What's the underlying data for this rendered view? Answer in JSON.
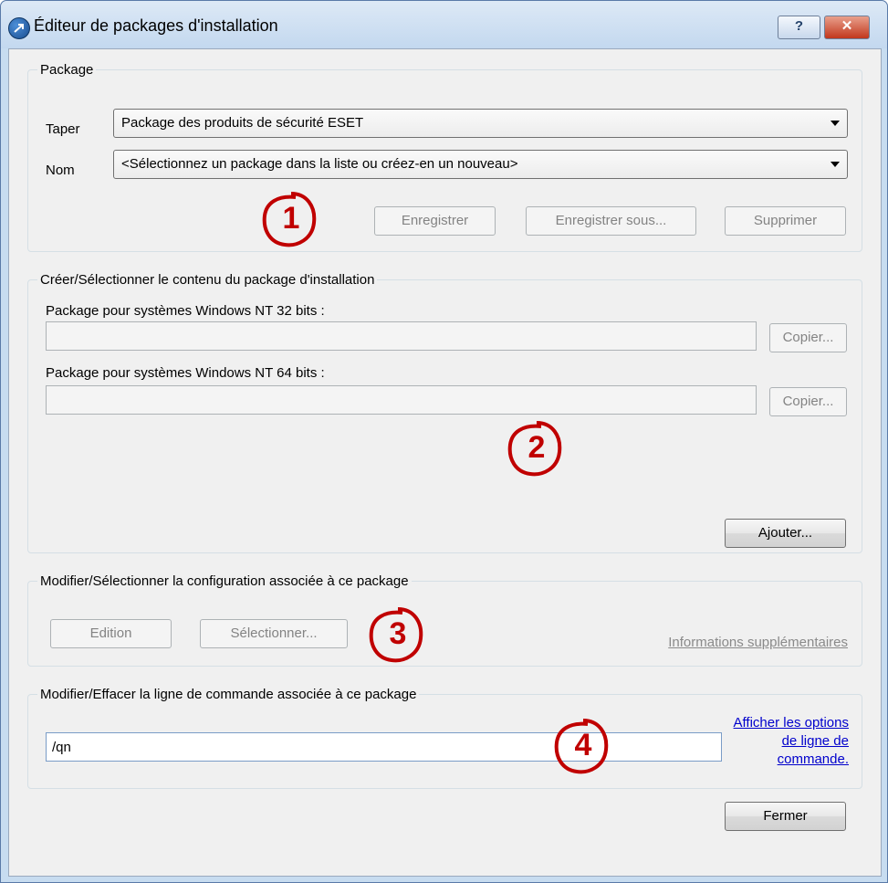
{
  "window": {
    "title": "Éditeur de packages d'installation",
    "help_label": "?",
    "close_label": "✕"
  },
  "package": {
    "legend": "Package",
    "type_label": "Taper",
    "type_value": "Package des produits de sécurité ESET",
    "name_label": "Nom",
    "name_value": "<Sélectionnez un package dans la liste ou créez-en un nouveau>",
    "save_label": "Enregistrer",
    "save_as_label": "Enregistrer sous...",
    "delete_label": "Supprimer"
  },
  "content": {
    "legend": "Créer/Sélectionner le contenu du package d'installation",
    "nt32_label": "Package pour systèmes Windows NT 32 bits :",
    "nt32_value": "",
    "nt64_label": "Package pour systèmes Windows NT 64 bits :",
    "nt64_value": "",
    "copy_label": "Copier...",
    "add_label": "Ajouter..."
  },
  "config": {
    "legend": "Modifier/Sélectionner la configuration associée à ce package",
    "edit_label": "Edition",
    "select_label": "Sélectionner...",
    "more_info_label": "Informations supplémentaires"
  },
  "cmdline": {
    "legend": "Modifier/Effacer la ligne de commande associée à ce package",
    "value": "/qn",
    "options_link": "Afficher les options de ligne de commande."
  },
  "close_label": "Fermer",
  "markers": [
    "1",
    "2",
    "3",
    "4"
  ],
  "colors": {
    "marker": "#c00000",
    "link": "#0000cc",
    "title_bar": "#c3d8ef"
  }
}
